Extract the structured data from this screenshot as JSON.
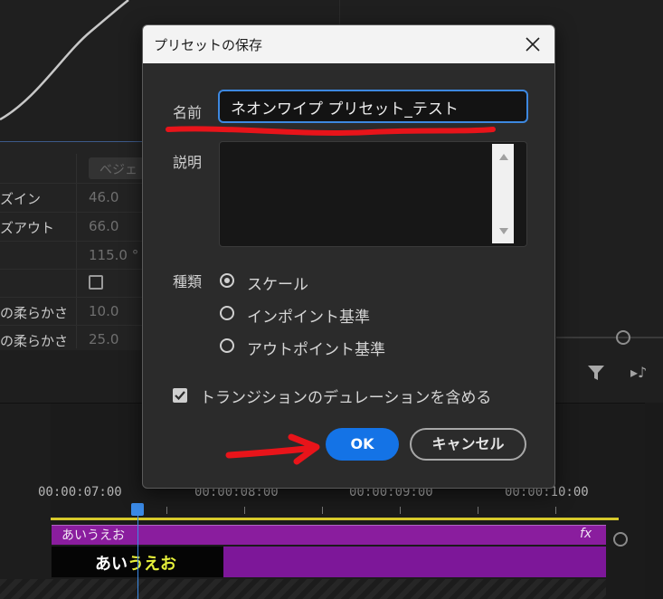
{
  "effect_controls": {
    "column_header": "ベジェ",
    "properties": [
      {
        "name": "ズイン",
        "value": "46.0"
      },
      {
        "name": "ズアウト",
        "value": "66.0"
      },
      {
        "name": "",
        "value": "115.0 °"
      },
      {
        "name": "",
        "value": ""
      },
      {
        "name": "の柔らかさ",
        "value": "10.0"
      },
      {
        "name": "の柔らかさ",
        "value": "25.0"
      }
    ]
  },
  "timeline": {
    "timecodes": [
      "00:00:07:00",
      "00:00:08:00",
      "00:00:09:00",
      "00:00:10:00"
    ],
    "audio_clip_label": "あいうえお",
    "fx_badge": "fx",
    "video_thumb_text_white": "あい",
    "video_thumb_text_yellow": "うえお"
  },
  "dialog": {
    "title": "プリセットの保存",
    "name_label": "名前",
    "name_value": "ネオンワイプ プリセット_テスト",
    "description_label": "説明",
    "description_value": "",
    "type_label": "種類",
    "type_options": [
      {
        "label": "スケール",
        "selected": true
      },
      {
        "label": "インポイント基準",
        "selected": false
      },
      {
        "label": "アウトポイント基準",
        "selected": false
      }
    ],
    "include_durations_label": "トランジションのデュレーションを含める",
    "include_durations_checked": true,
    "ok_label": "OK",
    "cancel_label": "キャンセル"
  },
  "colors": {
    "accent_blue": "#1473e6",
    "annotation_red": "#e8141a",
    "clip_purple": "#8a1d9e",
    "ruler_yellow": "#d6c92b"
  },
  "icons": [
    "close-icon",
    "filter-icon",
    "music-note-icon",
    "checkmark-icon",
    "scroll-up-arrow-icon",
    "scroll-down-arrow-icon"
  ]
}
